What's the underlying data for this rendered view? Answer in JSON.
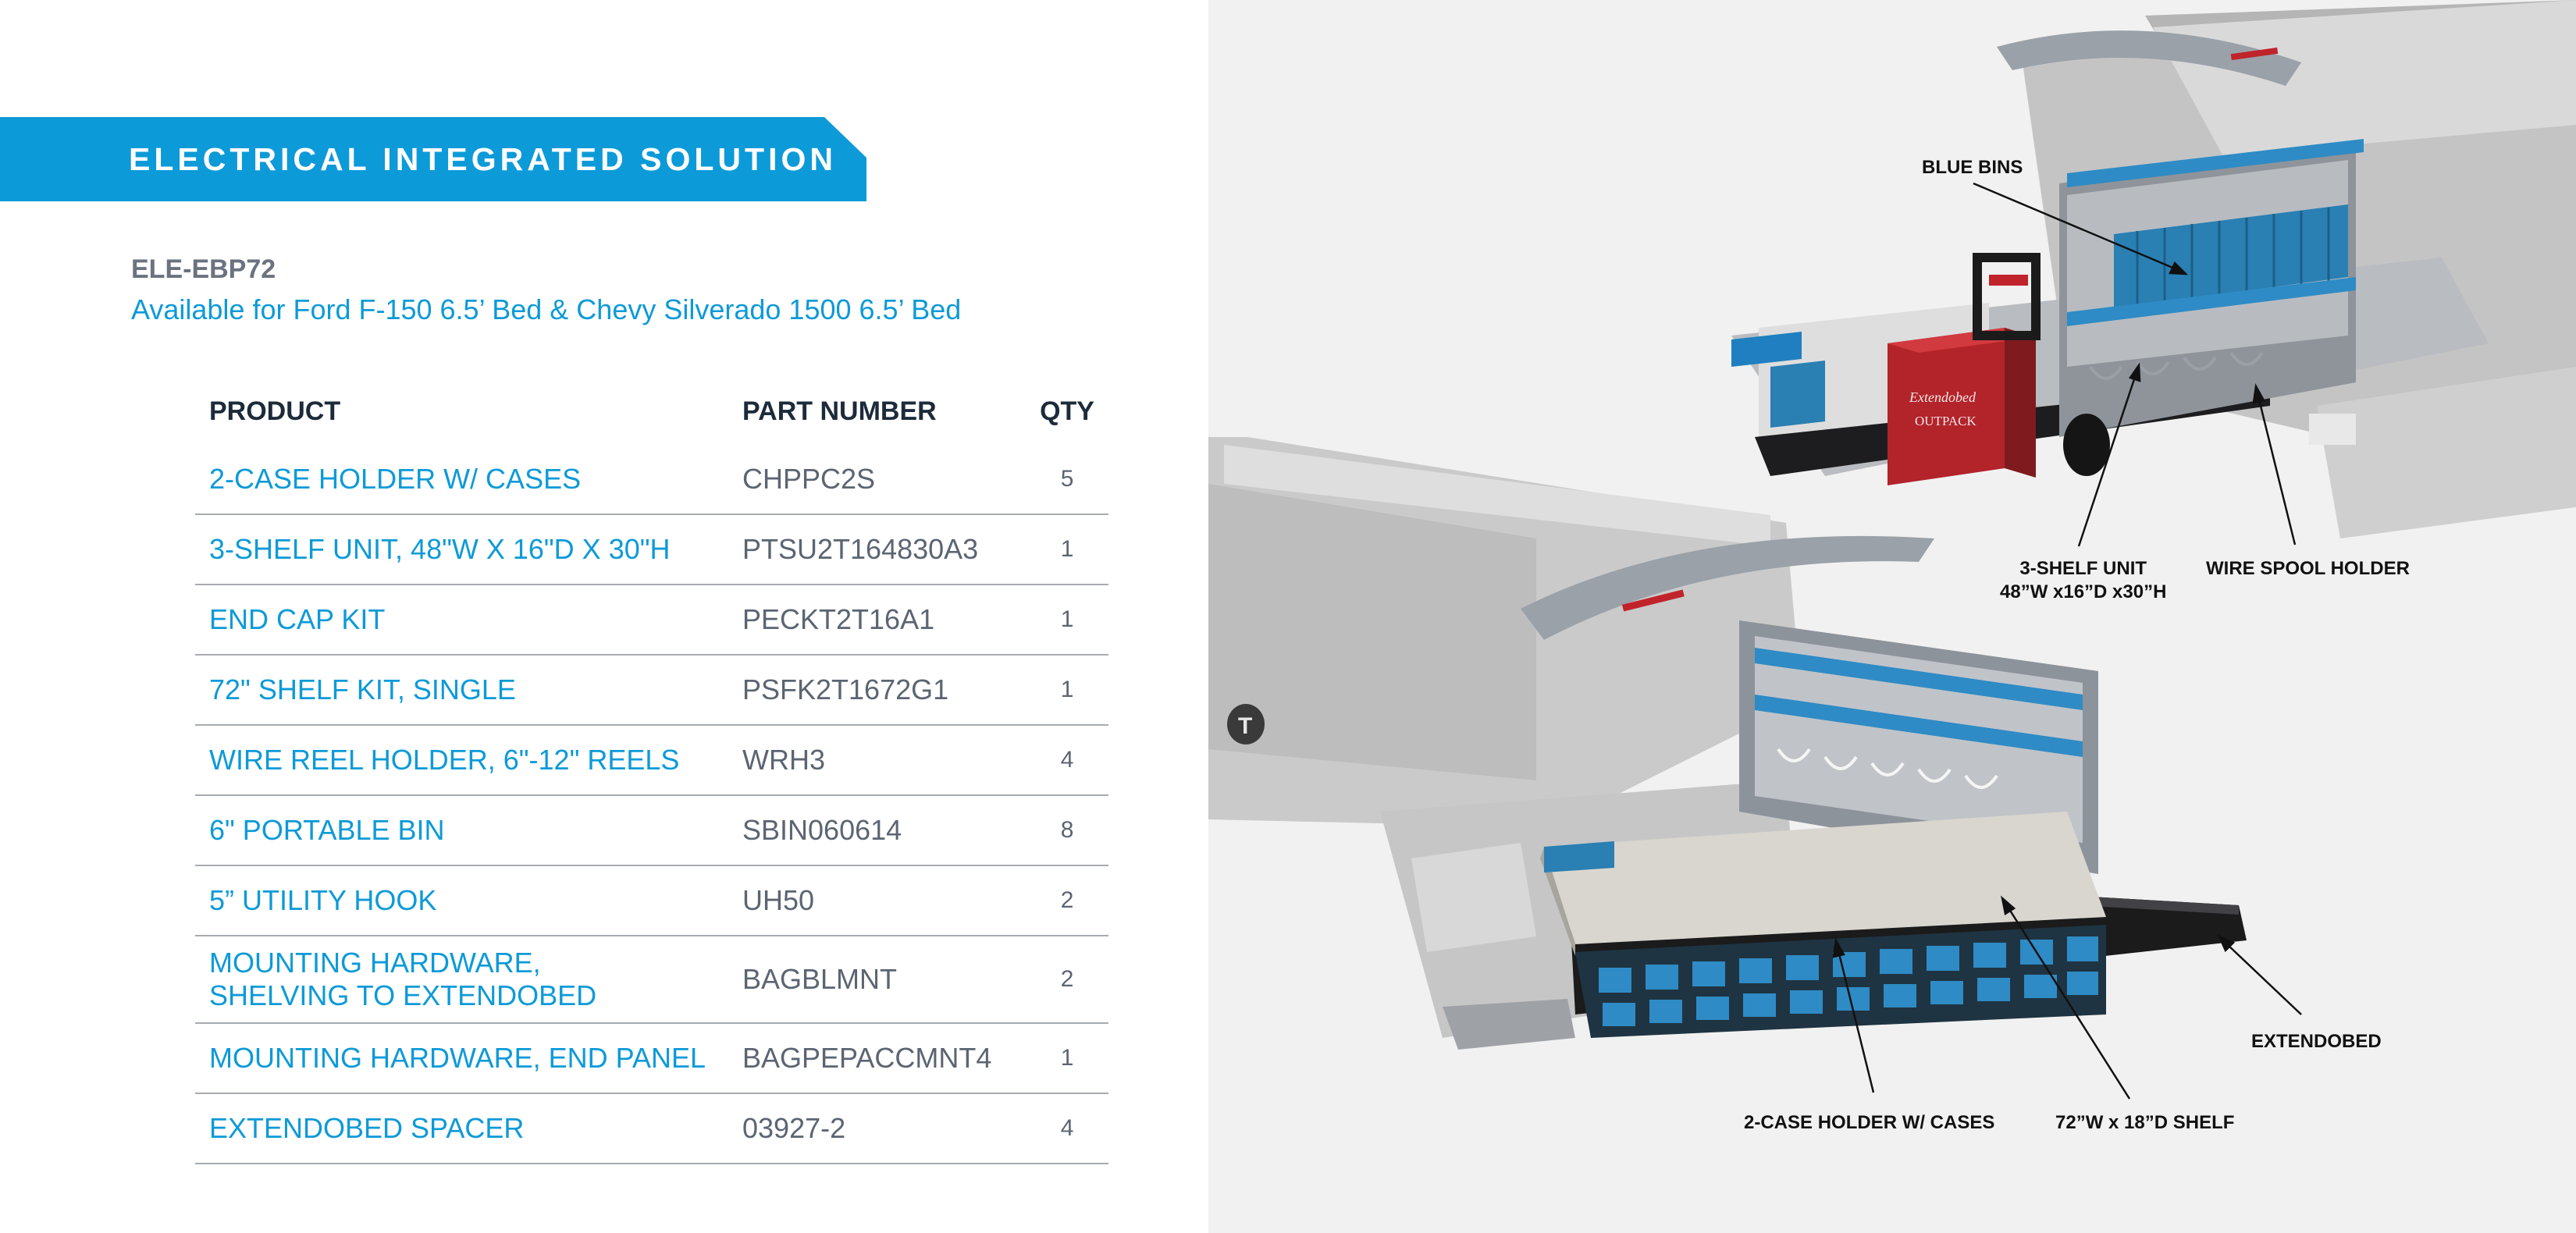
{
  "header": {
    "banner_title": "ELECTRICAL INTEGRATED SOLUTION",
    "model_code": "ELE-EBP72",
    "availability": "Available for Ford F-150 6.5’ Bed & Chevy Silverado 1500 6.5’ Bed"
  },
  "table": {
    "columns": [
      "PRODUCT",
      "PART NUMBER",
      "QTY"
    ],
    "rows": [
      {
        "product": [
          "2-CASE HOLDER W/ CASES"
        ],
        "part": "CHPPC2S",
        "qty": "5"
      },
      {
        "product": [
          "3-SHELF UNIT, 48\"W X 16\"D X 30\"H"
        ],
        "part": "PTSU2T164830A3",
        "qty": "1"
      },
      {
        "product": [
          "END CAP KIT"
        ],
        "part": "PECKT2T16A1",
        "qty": "1"
      },
      {
        "product": [
          "72\" SHELF KIT, SINGLE"
        ],
        "part": "PSFK2T1672G1",
        "qty": "1"
      },
      {
        "product": [
          "WIRE REEL HOLDER, 6\"-12\" REELS"
        ],
        "part": "WRH3",
        "qty": "4"
      },
      {
        "product": [
          "6\" PORTABLE BIN"
        ],
        "part": "SBIN060614",
        "qty": "8"
      },
      {
        "product": [
          "5” UTILITY HOOK"
        ],
        "part": "UH50",
        "qty": "2"
      },
      {
        "product": [
          "MOUNTING HARDWARE,",
          "SHELVING TO EXTENDOBED"
        ],
        "part": "BAGBLMNT",
        "qty": "2"
      },
      {
        "product": [
          "MOUNTING HARDWARE, END PANEL"
        ],
        "part": "BAGPEPACCMNT4",
        "qty": "1"
      },
      {
        "product": [
          "EXTENDOBED SPACER"
        ],
        "part": "03927-2",
        "qty": "4"
      }
    ]
  },
  "illustration": {
    "callouts": {
      "blue_bins": "BLUE BINS",
      "three_shelf_line1": "3-SHELF UNIT",
      "three_shelf_line2": "48”W x16”D x30”H",
      "wire_spool": "WIRE SPOOL HOLDER",
      "extendobed": "EXTENDOBED",
      "two_case": "2-CASE HOLDER W/ CASES",
      "shelf_72": "72”W x 18”D SHELF"
    },
    "case_labels": {
      "line1": "Extendobed",
      "line2": "OUTPACK"
    },
    "colors": {
      "accent_blue": "#0d9ad8",
      "truck_gray": "#c9c9c9",
      "red_case": "#b3232a"
    }
  }
}
